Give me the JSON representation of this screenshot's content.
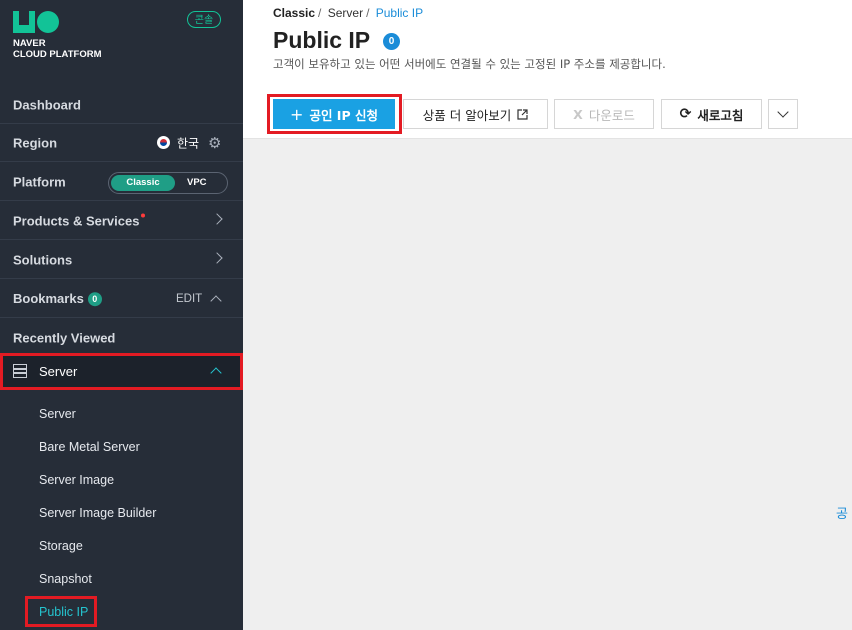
{
  "brand": {
    "line1": "NAVER",
    "line2": "CLOUD PLATFORM",
    "console_badge": "콘솔"
  },
  "sidebar": {
    "dashboard": "Dashboard",
    "region": {
      "label": "Region",
      "value": "한국"
    },
    "platform": {
      "label": "Platform",
      "options": [
        "Classic",
        "VPC"
      ],
      "selected": "Classic"
    },
    "products": "Products & Services",
    "solutions": "Solutions",
    "bookmarks": {
      "label": "Bookmarks",
      "count": "0",
      "edit": "EDIT"
    },
    "recently_viewed": "Recently Viewed",
    "server_section": "Server",
    "server_items": [
      "Server",
      "Bare Metal Server",
      "Server Image",
      "Server Image Builder",
      "Storage",
      "Snapshot",
      "Public IP"
    ]
  },
  "breadcrumb": {
    "root": "Classic",
    "parent": "Server",
    "current": "Public IP"
  },
  "page": {
    "title": "Public IP",
    "count": "0",
    "description": "고객이 보유하고 있는 어떤 서버에도 연결될 수 있는 고정된 IP 주소를 제공합니다."
  },
  "toolbar": {
    "apply": "공인 IP 신청",
    "learn_more": "상품 더 알아보기",
    "download": "다운로드",
    "refresh": "새로고침"
  },
  "edge_text": "공",
  "colors": {
    "accent": "#1aa1e3",
    "highlight": "#e31b23",
    "sidebar_bg": "#262d38",
    "teal": "#1f9e86"
  }
}
